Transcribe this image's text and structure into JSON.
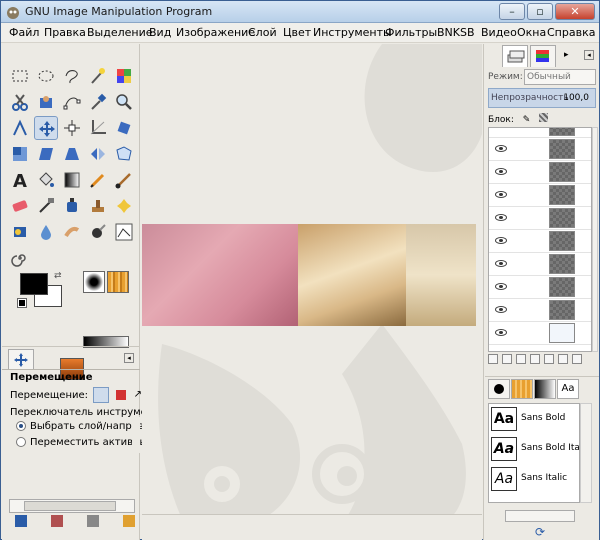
{
  "window": {
    "title": "GNU Image Manipulation Program",
    "buttons": [
      "–",
      "▫",
      "✕"
    ]
  },
  "menu": [
    "Файл",
    "Правка",
    "Выделение",
    "Вид",
    "Изображение",
    "Слой",
    "Цвет",
    "Инструменты",
    "Фильтры",
    "BNKSB",
    "Видео",
    "Окна",
    "Справка"
  ],
  "tool_options": {
    "title": "Перемещение",
    "move_label": "Перемещение:",
    "toggle_label": "Переключатель инструмента  (Shi",
    "radio1": "Выбрать слой/направляю",
    "radio2": "Переместить активный сло"
  },
  "layers": {
    "mode_label": "Режим:",
    "mode_value": "Обычный",
    "opacity_label": "Непрозрачность",
    "opacity_value": "100,0",
    "lock_label": "Блок:"
  },
  "fonts": [
    {
      "preview": "Aa",
      "name": "Sans Bold"
    },
    {
      "preview": "Aa",
      "name": "Sans Bold Italic"
    },
    {
      "preview": "Aa",
      "name": "Sans Italic"
    }
  ],
  "colors": {
    "accent": "#7b9bc4",
    "title_bg": "#c8daf0",
    "close_red": "#c5422e"
  }
}
